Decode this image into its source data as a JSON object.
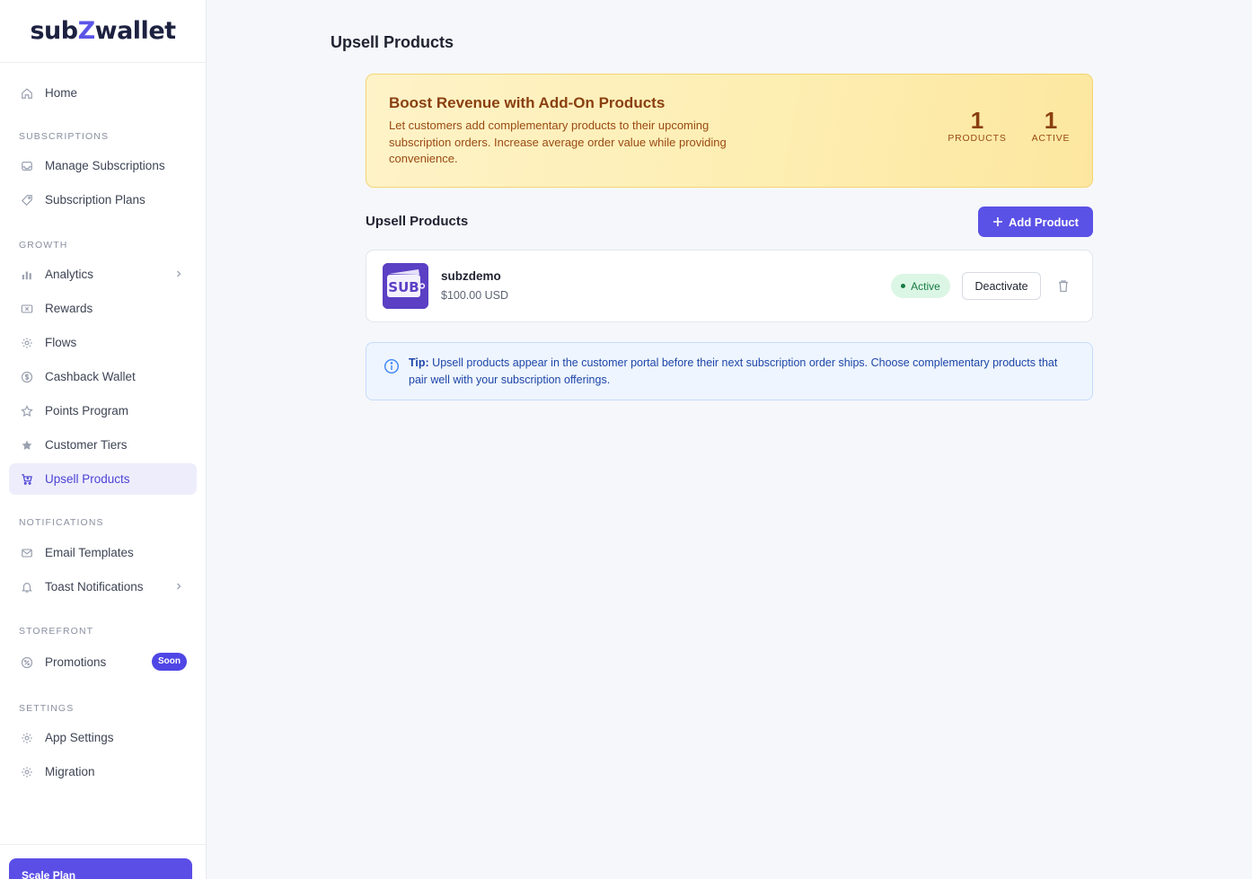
{
  "brand": {
    "prefix": "sub",
    "accent": "Z",
    "suffix": "wallet",
    "accent_color": "#5b55e8"
  },
  "sidebar": {
    "home": "Home",
    "sections": {
      "subscriptions": "SUBSCRIPTIONS",
      "growth": "GROWTH",
      "notifications": "NOTIFICATIONS",
      "storefront": "STOREFRONT",
      "settings": "SETTINGS"
    },
    "items": {
      "manage_subscriptions": "Manage Subscriptions",
      "subscription_plans": "Subscription Plans",
      "analytics": "Analytics",
      "rewards": "Rewards",
      "flows": "Flows",
      "cashback_wallet": "Cashback Wallet",
      "points_program": "Points Program",
      "customer_tiers": "Customer Tiers",
      "upsell_products": "Upsell Products",
      "email_templates": "Email Templates",
      "toast_notifications": "Toast Notifications",
      "promotions": "Promotions",
      "app_settings": "App Settings",
      "migration": "Migration"
    },
    "promotions_badge": "Soon",
    "active_item": "upsell_products",
    "plan_label": "Scale Plan"
  },
  "main": {
    "title": "Upsell Products",
    "banner": {
      "title": "Boost Revenue with Add-On Products",
      "description": "Let customers add complementary products to their upcoming subscription orders. Increase average order value while providing convenience.",
      "stats": [
        {
          "value": "1",
          "label": "PRODUCTS"
        },
        {
          "value": "1",
          "label": "ACTIVE"
        }
      ]
    },
    "list": {
      "heading": "Upsell Products",
      "add_button": "Add Product",
      "products": [
        {
          "name": "subzdemo",
          "price": "$100.00 USD",
          "status": "Active",
          "action": "Deactivate",
          "thumb_text": "SUB"
        }
      ]
    },
    "tip": {
      "label": "Tip:",
      "text": " Upsell products appear in the customer portal before their next subscription order ships. Choose complementary products that pair well with your subscription offerings."
    }
  },
  "colors": {
    "primary": "#5a51e6",
    "active_green": "#177a43",
    "banner_text": "#8a3f10",
    "tip_blue": "#1e46a8"
  }
}
